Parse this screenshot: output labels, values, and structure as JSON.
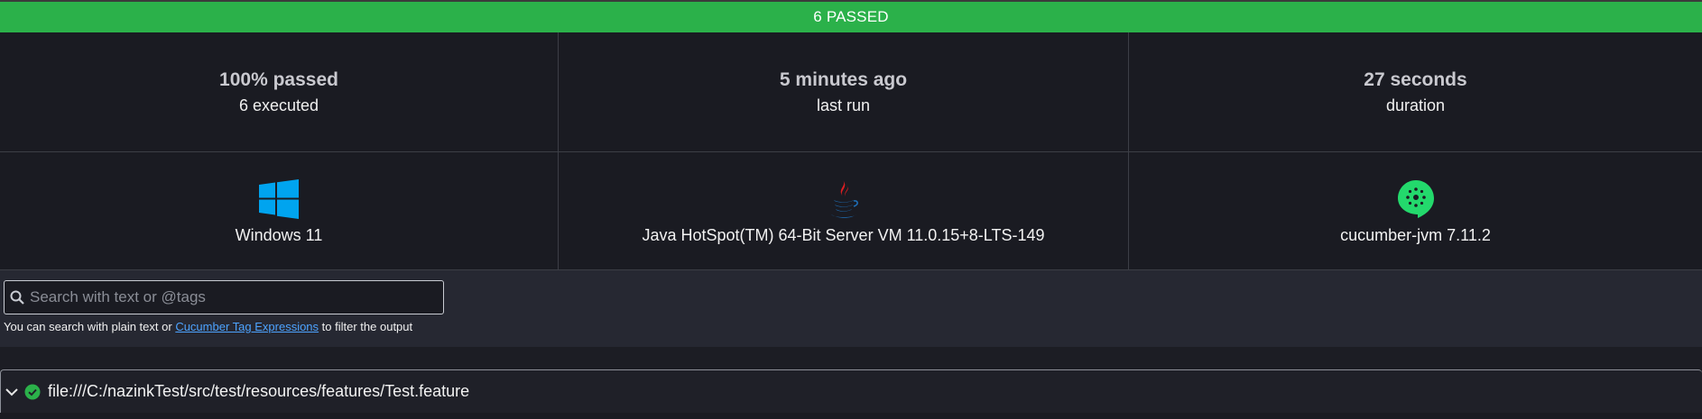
{
  "banner": {
    "text": "6 PASSED",
    "color": "#2bb14a"
  },
  "stats": [
    {
      "main": "100% passed",
      "sub": "6 executed"
    },
    {
      "main": "5 minutes ago",
      "sub": "last run"
    },
    {
      "main": "27 seconds",
      "sub": "duration"
    }
  ],
  "environment": [
    {
      "icon": "windows-icon",
      "label": "Windows 11"
    },
    {
      "icon": "java-icon",
      "label": "Java HotSpot(TM) 64-Bit Server VM 11.0.15+8-LTS-149"
    },
    {
      "icon": "cucumber-icon",
      "label": "cucumber-jvm 7.11.2"
    }
  ],
  "search": {
    "placeholder": "Search with text or @tags",
    "help_prefix": "You can search with plain text or",
    "help_link": "Cucumber Tag Expressions",
    "help_suffix": "to filter the output"
  },
  "feature": {
    "path": "file:///C:/nazinkTest/src/test/resources/features/Test.feature",
    "status": "passed",
    "status_color": "#2bb14a"
  }
}
